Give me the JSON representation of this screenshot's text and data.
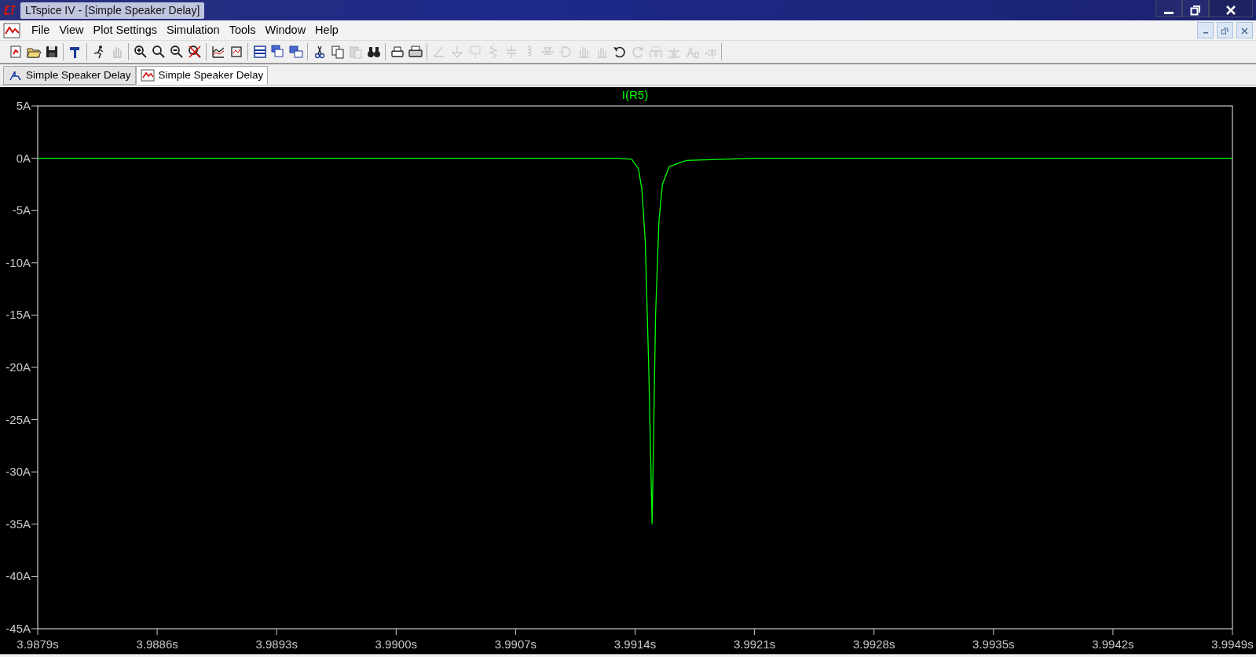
{
  "window": {
    "title": "LTspice IV - [Simple Speaker Delay]"
  },
  "menu": [
    {
      "label": "File"
    },
    {
      "label": "View"
    },
    {
      "label": "Plot Settings"
    },
    {
      "label": "Simulation"
    },
    {
      "label": "Tools"
    },
    {
      "label": "Window"
    },
    {
      "label": "Help"
    }
  ],
  "toolbar": [
    {
      "disabled": false
    },
    {
      "disabled": false
    },
    {
      "disabled": false
    },
    {
      "disabled": false
    },
    {
      "disabled": false
    },
    {
      "disabled": true
    },
    {
      "disabled": false
    },
    {
      "disabled": false
    },
    {
      "disabled": false
    },
    {
      "disabled": false
    },
    {
      "disabled": false
    },
    {
      "disabled": false
    },
    {
      "disabled": false
    },
    {
      "disabled": false
    },
    {
      "disabled": false
    },
    {
      "disabled": false
    },
    {
      "disabled": false
    },
    {
      "disabled": true
    },
    {
      "disabled": false
    },
    {
      "disabled": false
    },
    {
      "disabled": false
    },
    {
      "disabled": true
    },
    {
      "disabled": true
    },
    {
      "disabled": true
    },
    {
      "disabled": true
    },
    {
      "disabled": true
    },
    {
      "disabled": true
    },
    {
      "disabled": true
    },
    {
      "disabled": true
    },
    {
      "disabled": true
    },
    {
      "disabled": true
    },
    {
      "disabled": false
    },
    {
      "disabled": true
    },
    {
      "disabled": true
    },
    {
      "disabled": true
    },
    {
      "disabled": true
    },
    {
      "disabled": true
    }
  ],
  "tabs": [
    {
      "label": "Simple Speaker Delay",
      "kind": "schematic",
      "selected": false
    },
    {
      "label": "Simple Speaker Delay",
      "kind": "waveform",
      "selected": true
    }
  ],
  "plot": {
    "chart_data": {
      "type": "line",
      "x": [
        3.9879,
        3.9913,
        3.99138,
        3.99142,
        3.99144,
        3.99146,
        3.99148,
        3.9915,
        3.99152,
        3.99154,
        3.99156,
        3.9916,
        3.9917,
        3.9921,
        3.9949
      ],
      "series": [
        {
          "name": "I(R5)",
          "color": "#00ff00",
          "values": [
            0,
            0,
            -0.1,
            -1,
            -3,
            -8,
            -20,
            -35,
            -15,
            -6,
            -2.5,
            -0.8,
            -0.2,
            0,
            0
          ]
        }
      ],
      "xlim": [
        3.9879,
        3.9949
      ],
      "ylim": [
        -45,
        5
      ],
      "xticks": [
        {
          "value": 3.9879,
          "label": "3.9879s"
        },
        {
          "value": 3.9886,
          "label": "3.9886s"
        },
        {
          "value": 3.9893,
          "label": "3.9893s"
        },
        {
          "value": 3.99,
          "label": "3.9900s"
        },
        {
          "value": 3.9907,
          "label": "3.9907s"
        },
        {
          "value": 3.9914,
          "label": "3.9914s"
        },
        {
          "value": 3.9921,
          "label": "3.9921s"
        },
        {
          "value": 3.9928,
          "label": "3.9928s"
        },
        {
          "value": 3.9935,
          "label": "3.9935s"
        },
        {
          "value": 3.9942,
          "label": "3.9942s"
        },
        {
          "value": 3.9949,
          "label": "3.9949s"
        }
      ],
      "yticks": [
        {
          "value": 5,
          "label": "5A"
        },
        {
          "value": 0,
          "label": "0A"
        },
        {
          "value": -5,
          "label": "-5A"
        },
        {
          "value": -10,
          "label": "-10A"
        },
        {
          "value": -15,
          "label": "-15A"
        },
        {
          "value": -20,
          "label": "-20A"
        },
        {
          "value": -25,
          "label": "-25A"
        },
        {
          "value": -30,
          "label": "-30A"
        },
        {
          "value": -35,
          "label": "-35A"
        },
        {
          "value": -40,
          "label": "-40A"
        },
        {
          "value": -45,
          "label": "-45A"
        }
      ]
    }
  }
}
